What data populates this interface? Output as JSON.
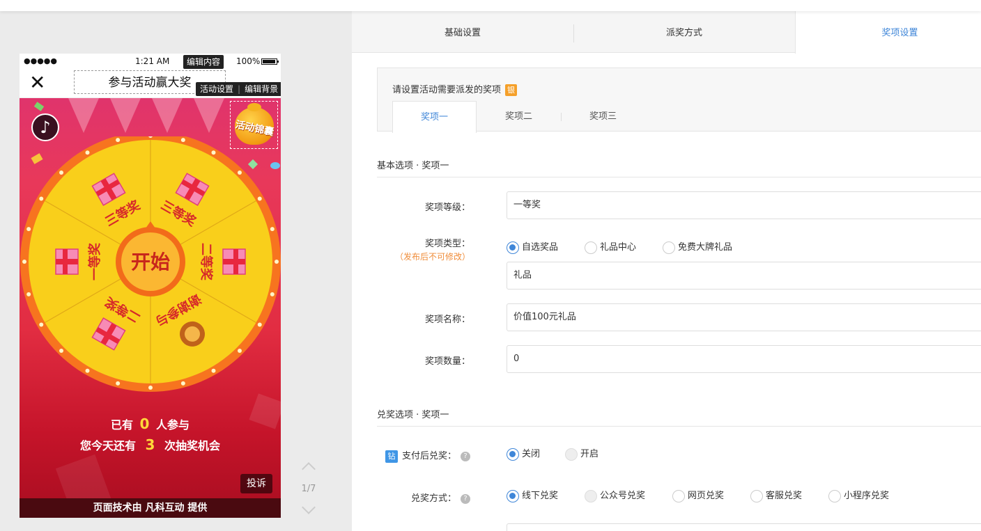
{
  "phone": {
    "status": {
      "dots": "●●●●●",
      "time": "1:21 AM",
      "battery": "100%"
    },
    "edit_content": "编辑内容",
    "edit_activity": "活动设置",
    "edit_background": "编辑背景",
    "close_glyph": "✕",
    "title": "参与活动赢大奖",
    "music_glyph": "♪",
    "bag_text": "活动锦囊",
    "start_label": "开始",
    "wheel_prizes": [
      "三等奖",
      "三等奖",
      "二等奖",
      "谢谢参与",
      "二等奖",
      "一等奖"
    ],
    "participants_prefix": "已有",
    "participants_count": "0",
    "participants_suffix": "人参与",
    "chances_prefix": "您今天还有",
    "chances_count": "3",
    "chances_suffix": "次抽奖机会",
    "complain_label": "投诉",
    "footer": "页面技术由 凡科互动 提供"
  },
  "pager": {
    "count": "1/7"
  },
  "tabs": [
    "基础设置",
    "派奖方式",
    "奖项设置"
  ],
  "prize_section": {
    "hint": "请设置活动需要派发的奖项",
    "hint_badge": "银",
    "sub_tabs": [
      "奖项一",
      "奖项二",
      "奖项三"
    ]
  },
  "basic": {
    "title": "基本选项 · 奖项一",
    "level_label": "奖项等级：",
    "level_value": "一等奖",
    "type_label": "奖项类型：",
    "type_note": "（发布后不可修改）",
    "type_options": [
      "自选奖品",
      "礼品中心",
      "免费大牌礼品"
    ],
    "type_value": "礼品",
    "name_label": "奖项名称：",
    "name_value": "价值100元礼品",
    "qty_label": "奖项数量：",
    "qty_value": "0"
  },
  "redeem": {
    "title": "兑奖选项 · 奖项一",
    "pay_icon": "钻",
    "pay_label": "支付后兑奖：",
    "pay_options": [
      "关闭",
      "开启"
    ],
    "method_label": "兑奖方式：",
    "method_options": [
      "线下兑奖",
      "公众号兑奖",
      "网页兑奖",
      "客服兑奖",
      "小程序兑奖"
    ],
    "help_glyph": "?"
  },
  "colors": {
    "accent": "#3f86d8",
    "warning": "#f08d3a",
    "wheel_yellow": "#f9cf1b",
    "wheel_rim": "#f7741f",
    "wheel_text": "#d6282a"
  }
}
